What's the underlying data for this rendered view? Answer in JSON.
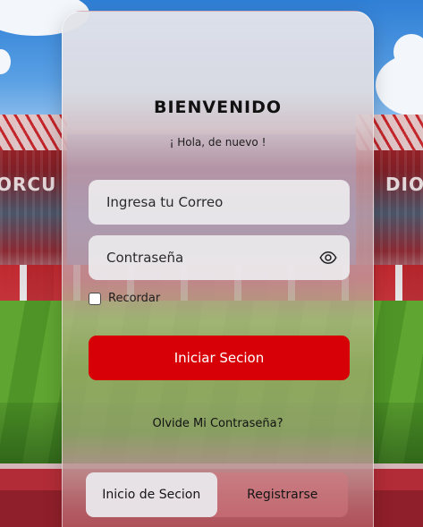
{
  "background": {
    "left_banner_text": "ORCU",
    "right_banner_text": "DIO"
  },
  "login": {
    "title": "BIENVENIDO",
    "subtitle": "¡ Hola, de nuevo !",
    "email_placeholder": "Ingresa tu Correo",
    "password_placeholder": "Contraseña",
    "password_toggle_icon": "eye-icon",
    "remember_label": "Recordar",
    "remember_checked": false,
    "submit_label": "Iniciar Secion",
    "forgot_label": "Olvide Mi Contraseña?"
  },
  "tabs": {
    "items": [
      {
        "label": "Inicio de Secion",
        "active": true
      },
      {
        "label": "Registrarse",
        "active": false
      }
    ]
  },
  "colors": {
    "accent": "#d70007",
    "field_bg": "#ece9ed"
  }
}
